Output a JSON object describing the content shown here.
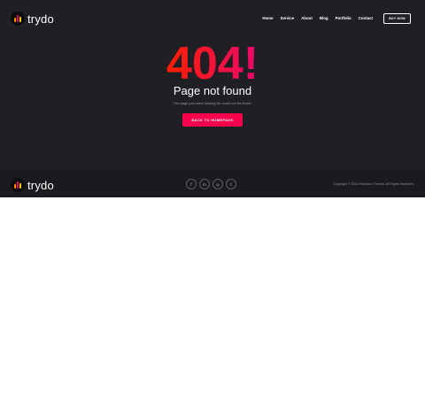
{
  "brand": {
    "name": "trydo"
  },
  "nav": {
    "items": [
      {
        "label": "Home"
      },
      {
        "label": "Service"
      },
      {
        "label": "About"
      },
      {
        "label": "Blog"
      },
      {
        "label": "Portfolio"
      },
      {
        "label": "Contact"
      }
    ],
    "buy_label": "BUY NOW"
  },
  "error": {
    "code": "404!",
    "title": "Page not found",
    "message": "The page you were looking for could not be found.",
    "back_label": "BACK TO HOMEPAGE"
  },
  "footer": {
    "socials": [
      {
        "icon": "facebook-icon",
        "glyph": "f"
      },
      {
        "icon": "linkedin-icon",
        "glyph": "in"
      },
      {
        "icon": "instagram-icon",
        "glyph": "◎"
      },
      {
        "icon": "twitter-icon",
        "glyph": "t"
      }
    ],
    "copyright": "Copyright © 2020 Rainbow-Themes. All Rights Reserved."
  },
  "colors": {
    "background": "#1f1f24",
    "accent": "#f9004d",
    "gradient_start": "#f81f01",
    "gradient_end": "#ee076e"
  }
}
